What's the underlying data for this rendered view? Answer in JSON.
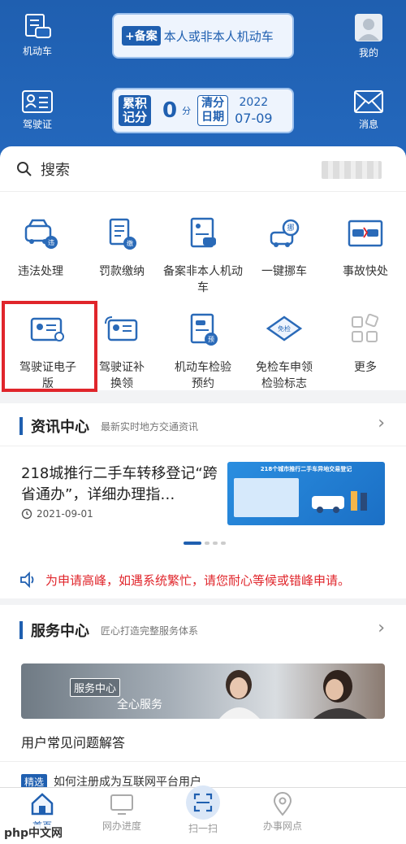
{
  "header": {
    "vehicle_label": "机动车",
    "my_label": "我的",
    "license_label": "驾驶证",
    "message_label": "消息",
    "banner_tag": "+备案",
    "banner_text": "本人或非本人机动车",
    "score_label": "累积记分",
    "score_value": "0",
    "score_unit": "分",
    "clear_label": "清分日期",
    "clear_year": "2022",
    "clear_date": "07-09"
  },
  "search": {
    "placeholder": "搜索"
  },
  "services": [
    {
      "label": "违法处理",
      "icon": "car-violation-icon"
    },
    {
      "label": "罚款缴纳",
      "icon": "fine-payment-icon"
    },
    {
      "label": "备案非本人机动车",
      "icon": "register-vehicle-icon"
    },
    {
      "label": "一键挪车",
      "icon": "move-car-icon"
    },
    {
      "label": "事故快处",
      "icon": "accident-icon"
    },
    {
      "label": "驾驶证电子版",
      "icon": "e-license-icon"
    },
    {
      "label": "驾驶证补换领",
      "icon": "license-replace-icon"
    },
    {
      "label": "机动车检验预约",
      "icon": "inspection-booking-icon"
    },
    {
      "label": "免检车申领检验标志",
      "icon": "exempt-inspection-icon"
    },
    {
      "label": "更多",
      "icon": "more-icon"
    }
  ],
  "news": {
    "title": "资讯中心",
    "subtitle": "最新实时地方交通资讯",
    "headline": "218城推行二手车转移登记“跨省通办”，详细办理指…",
    "date": "2021-09-01",
    "image_caption": "218个城市推行二手车异地交易登记"
  },
  "notice": {
    "text": "为申请高峰，如遇系统繁忙，请您耐心等候或错峰申请。"
  },
  "service_center": {
    "title": "服务中心",
    "subtitle": "匠心打造完整服务体系",
    "banner_tag": "服务中心",
    "banner_text": "全心服务",
    "faq_title": "用户常见问题解答",
    "faq_badge": "精选",
    "faq_item": "如何注册成为互联网平台用户"
  },
  "nav": [
    {
      "label": "首页",
      "icon": "home-icon"
    },
    {
      "label": "网办进度",
      "icon": "monitor-icon"
    },
    {
      "label": "扫一扫",
      "icon": "scan-icon"
    },
    {
      "label": "办事网点",
      "icon": "location-icon"
    }
  ],
  "watermark": "php中文网",
  "colors": {
    "primary": "#1f5fb0",
    "highlight": "#e0252b"
  }
}
